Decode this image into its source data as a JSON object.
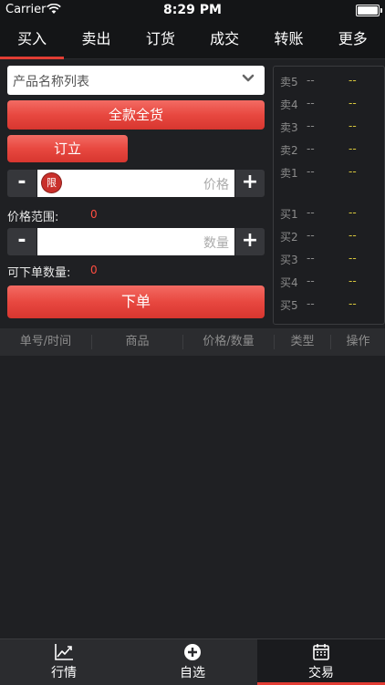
{
  "status_bar": {
    "carrier": "Carrier",
    "time": "8:29 PM",
    "icons": [
      "wifi-icon",
      "battery-icon"
    ]
  },
  "top_tabs": [
    {
      "label": "买入",
      "active": true
    },
    {
      "label": "卖出",
      "active": false
    },
    {
      "label": "订货",
      "active": false
    },
    {
      "label": "成交",
      "active": false
    },
    {
      "label": "转账",
      "active": false
    },
    {
      "label": "更多",
      "active": false
    }
  ],
  "form": {
    "product_select_value": "产品名称列表",
    "all_goods_label": "全款全货",
    "order_label": "订立",
    "price": {
      "minus": "-",
      "plus": "+",
      "badge": "限",
      "placeholder": "价格",
      "range_label": "价格范围:",
      "range_value": "0"
    },
    "quantity": {
      "minus": "-",
      "plus": "+",
      "placeholder": "数量",
      "orderable_label": "可下单数量:",
      "orderable_value": "0"
    },
    "submit_label": "下单"
  },
  "order_book": {
    "sell": [
      {
        "label": "卖5",
        "price": "--",
        "volume": "--"
      },
      {
        "label": "卖4",
        "price": "--",
        "volume": "--"
      },
      {
        "label": "卖3",
        "price": "--",
        "volume": "--"
      },
      {
        "label": "卖2",
        "price": "--",
        "volume": "--"
      },
      {
        "label": "卖1",
        "price": "--",
        "volume": "--"
      }
    ],
    "buy": [
      {
        "label": "买1",
        "price": "--",
        "volume": "--"
      },
      {
        "label": "买2",
        "price": "--",
        "volume": "--"
      },
      {
        "label": "买3",
        "price": "--",
        "volume": "--"
      },
      {
        "label": "买4",
        "price": "--",
        "volume": "--"
      },
      {
        "label": "买5",
        "price": "--",
        "volume": "--"
      }
    ]
  },
  "table": {
    "columns": [
      "单号/时间",
      "商品",
      "价格/数量",
      "类型",
      "操作"
    ]
  },
  "bottom_tabs": [
    {
      "label": "行情",
      "icon": "chart-trend-icon",
      "active": false
    },
    {
      "label": "自选",
      "icon": "add-circle-icon",
      "active": false
    },
    {
      "label": "交易",
      "icon": "calendar-icon",
      "active": true
    }
  ],
  "colors": {
    "accent_red": "#e23d34",
    "ask_volume": "#d8c73c",
    "background": "#1f2023"
  }
}
